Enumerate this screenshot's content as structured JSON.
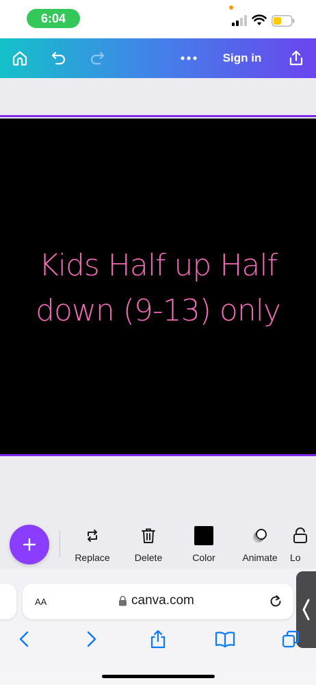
{
  "status_bar": {
    "time": "6:04",
    "icons": [
      "orange-dot",
      "cellular-signal-icon",
      "wifi-icon",
      "battery-low-icon"
    ],
    "battery_color": "#ffcc00"
  },
  "topbar": {
    "gradient": [
      "#14c1c9",
      "#3f87e8",
      "#6a45ee"
    ],
    "icons": [
      "home-icon",
      "undo-icon",
      "redo-icon",
      "more-icon",
      "share-icon"
    ],
    "sign_in_label": "Sign in"
  },
  "design": {
    "text_line_1": "Kids Half up Half",
    "text_line_2": "down (9-13) only",
    "background": "#000000",
    "text_color": "#f06bb8",
    "selection_color": "#7d2ae8"
  },
  "toolbar": {
    "add_icon": "plus-icon",
    "tools": [
      {
        "label": "Replace",
        "icon": "replace-icon"
      },
      {
        "label": "Delete",
        "icon": "trash-icon"
      },
      {
        "label": "Color",
        "icon": "color-swatch",
        "value": "#000000"
      },
      {
        "label": "Animate",
        "icon": "animate-icon"
      },
      {
        "label": "Lo",
        "icon": "lock-icon"
      }
    ]
  },
  "browser": {
    "text_size_label": "AA",
    "url": "canva.com",
    "icons": [
      "lock-icon",
      "reload-icon",
      "chevron-left-icon",
      "back-icon",
      "forward-icon",
      "share-icon",
      "bookmarks-icon",
      "tabs-icon"
    ]
  }
}
